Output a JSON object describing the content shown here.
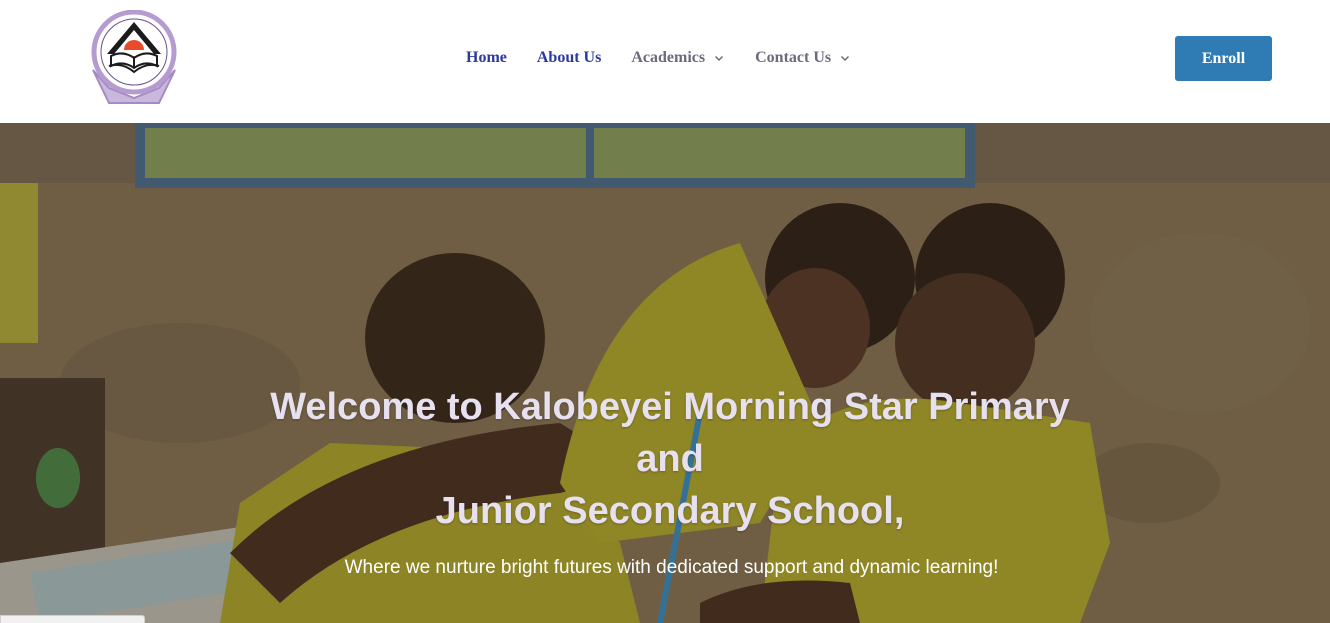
{
  "brand": {
    "logo_icon": "school-crest-icon",
    "accent_color": "#2f7bb3",
    "nav_active_color": "#2b3a9a",
    "nav_color": "#6b6b7b"
  },
  "nav": {
    "home": "Home",
    "about": "About Us",
    "academics": "Academics",
    "contact": "Contact Us"
  },
  "cta": {
    "enroll": "Enroll"
  },
  "hero": {
    "title_line1": "Welcome to Kalobeyei Morning Star Primary",
    "title_line2": "and",
    "title_line3": "Junior Secondary School,",
    "subtitle": "Where we nurture bright futures with dedicated support and dynamic learning!",
    "image_icon": "students-classroom-photo"
  },
  "status_bar": {
    "text": "..."
  }
}
